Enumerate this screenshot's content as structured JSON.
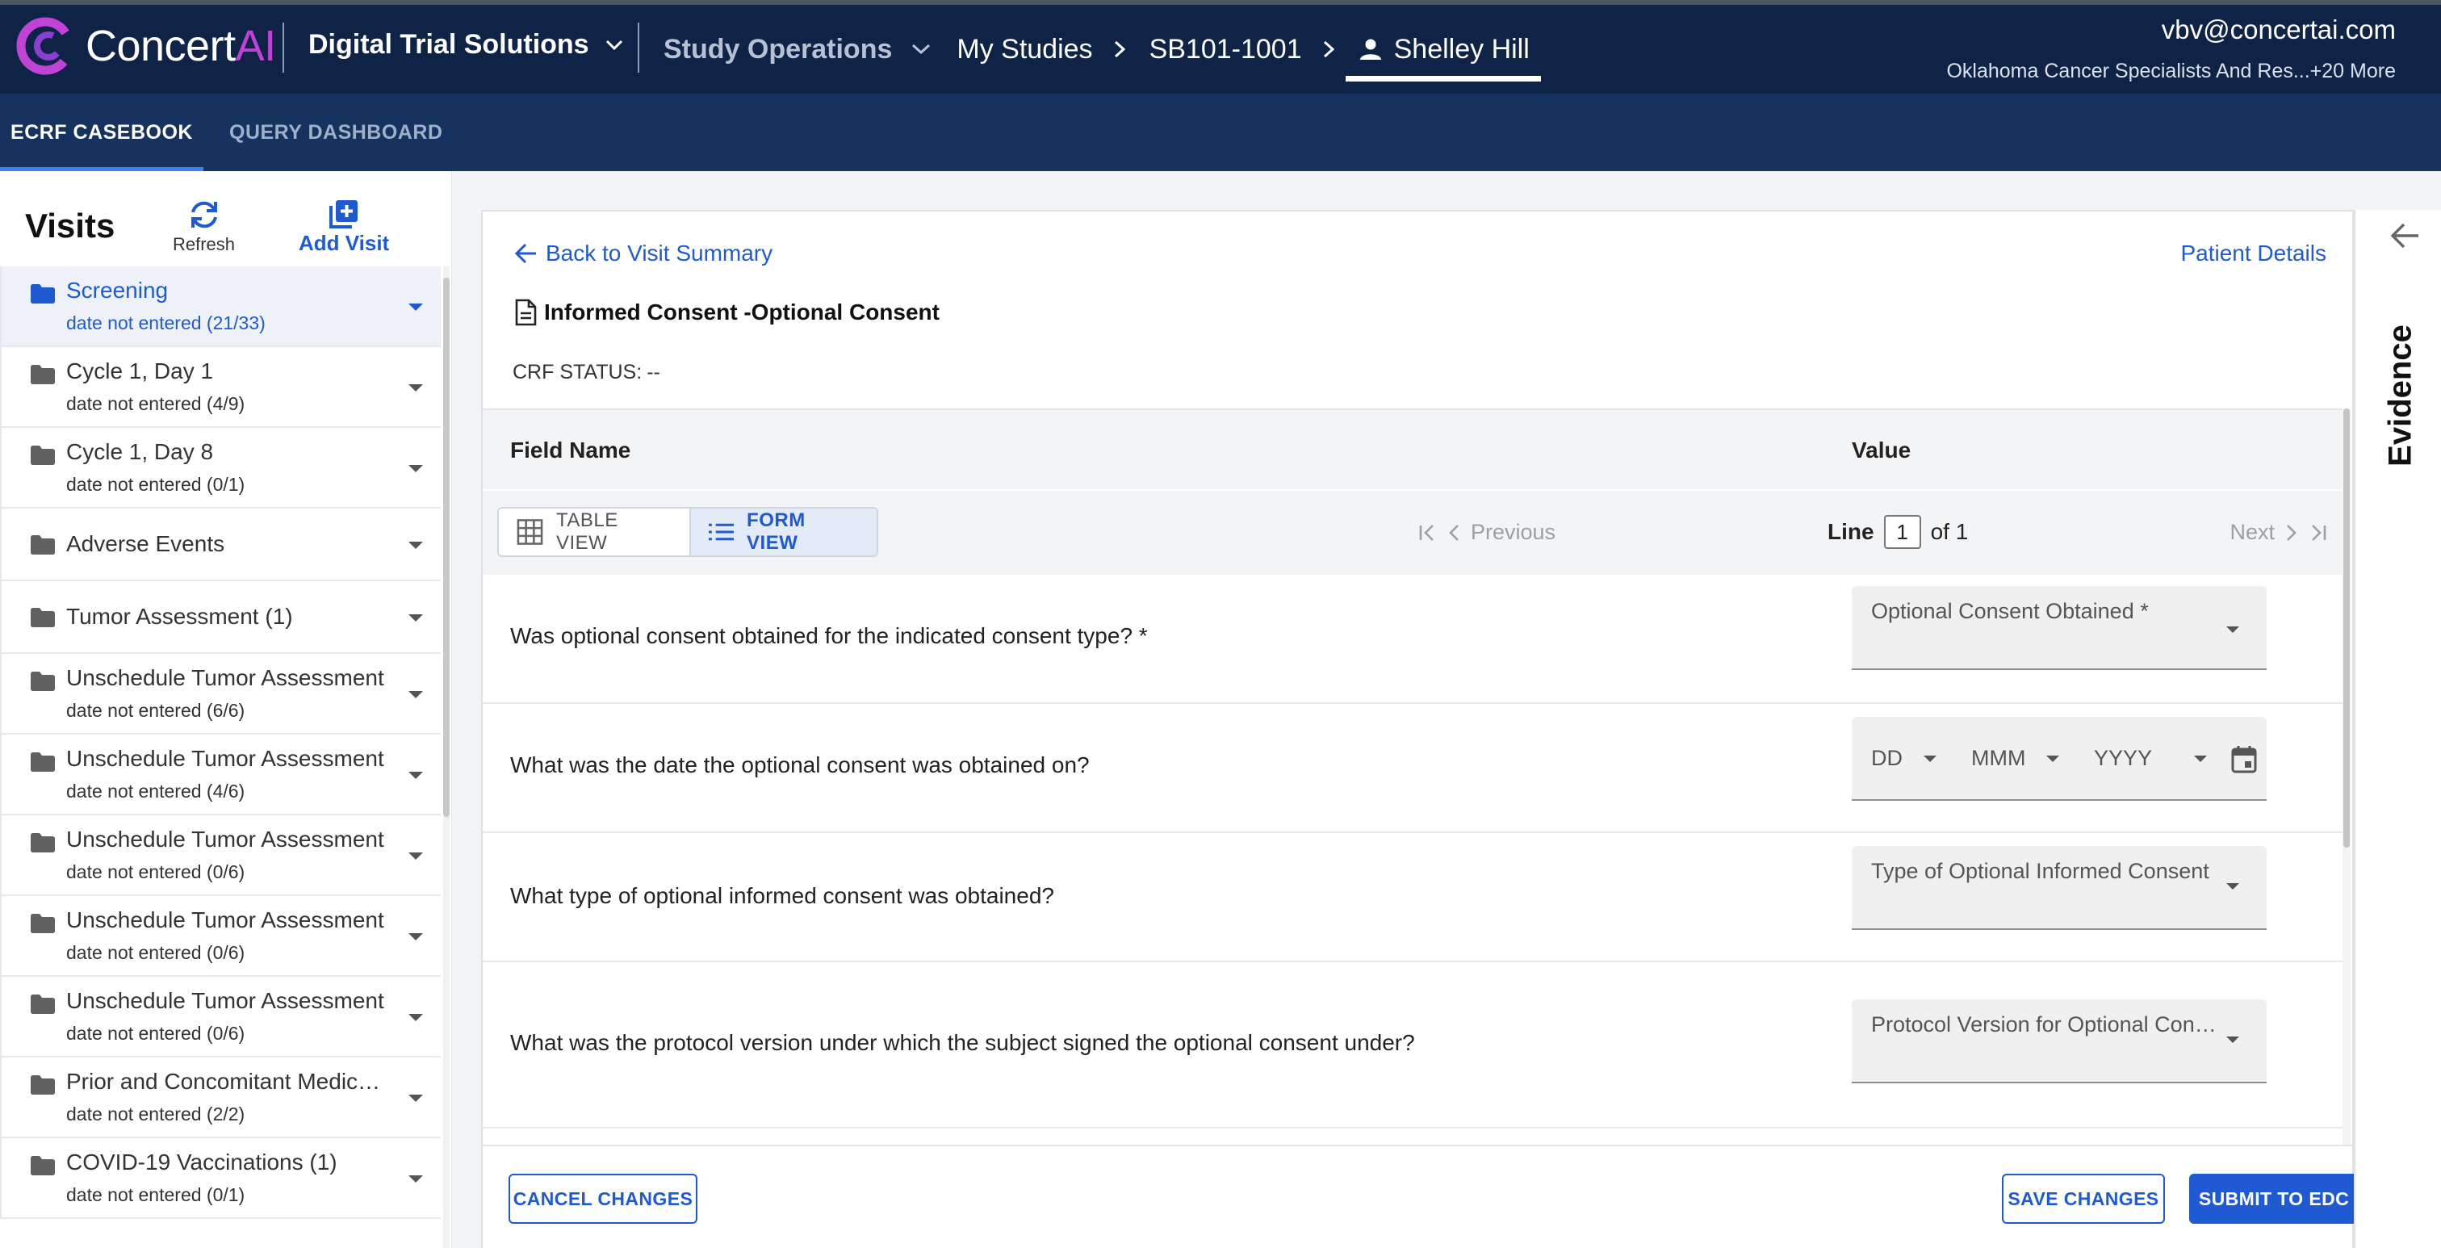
{
  "brand": {
    "name": "Concert",
    "name_accent": "AI"
  },
  "header": {
    "product": "Digital Trial Solutions",
    "breadcrumbs": [
      "Study Operations",
      "My Studies",
      "SB101-1001",
      "Shelley Hill"
    ],
    "user_email": "vbv@concertai.com",
    "user_org": "Oklahoma Cancer Specialists And Res...+20 More"
  },
  "subnav": {
    "tabs": [
      "ECRF CASEBOOK",
      "QUERY DASHBOARD"
    ],
    "active": "ECRF CASEBOOK"
  },
  "sidebar": {
    "title": "Visits",
    "refresh_label": "Refresh",
    "add_visit_label": "Add Visit",
    "visits": [
      {
        "name": "Screening",
        "sub": "date not entered (21/33)",
        "selected": true
      },
      {
        "name": "Cycle 1, Day 1",
        "sub": "date not entered (4/9)"
      },
      {
        "name": "Cycle 1, Day 8",
        "sub": "date not entered (0/1)"
      },
      {
        "name": "Adverse Events",
        "sub": ""
      },
      {
        "name": "Tumor Assessment (1)",
        "sub": ""
      },
      {
        "name": "Unschedule Tumor Assessment",
        "sub": "date not entered (6/6)"
      },
      {
        "name": "Unschedule Tumor Assessment",
        "sub": "date not entered (4/6)"
      },
      {
        "name": "Unschedule Tumor Assessment",
        "sub": "date not entered (0/6)"
      },
      {
        "name": "Unschedule Tumor Assessment",
        "sub": "date not entered (0/6)"
      },
      {
        "name": "Unschedule Tumor Assessment",
        "sub": "date not entered (0/6)"
      },
      {
        "name": "Prior and Concomitant Medications",
        "sub": "date not entered (2/2)"
      },
      {
        "name": "COVID-19 Vaccinations (1)",
        "sub": "date not entered (0/1)"
      }
    ]
  },
  "main": {
    "back_link": "Back to Visit Summary",
    "patient_link": "Patient Details",
    "form_title": "Informed Consent -Optional Consent",
    "crf_status_label": "CRF STATUS:",
    "crf_status_value": "--",
    "col_field": "Field Name",
    "col_value": "Value",
    "table_view": "TABLE VIEW",
    "form_view": "FORM VIEW",
    "previous": "Previous",
    "next": "Next",
    "line_label": "Line",
    "line_value": "1",
    "line_of": "of 1",
    "questions": [
      {
        "q": "Was optional consent obtained for the indicated consent type? *",
        "placeholder": "Optional Consent Obtained *"
      },
      {
        "q": "What was the date the optional consent was obtained on?",
        "date_parts": [
          "DD",
          "MMM",
          "YYYY"
        ]
      },
      {
        "q": "What type of optional informed consent was obtained?",
        "placeholder": "Type of Optional Informed Consent"
      },
      {
        "q": "What was the protocol version under which the subject signed the optional consent under?",
        "placeholder": "Protocol Version for Optional Consent"
      }
    ],
    "cancel_label": "CANCEL CHANGES",
    "save_label": "SAVE CHANGES",
    "submit_label": "SUBMIT TO EDC"
  },
  "evidence": {
    "label": "Evidence"
  },
  "colors": {
    "navy": "#0f2347",
    "subnav": "#16325f",
    "accent": "#1f5ad3",
    "brand_magenta": "#c043d6"
  }
}
